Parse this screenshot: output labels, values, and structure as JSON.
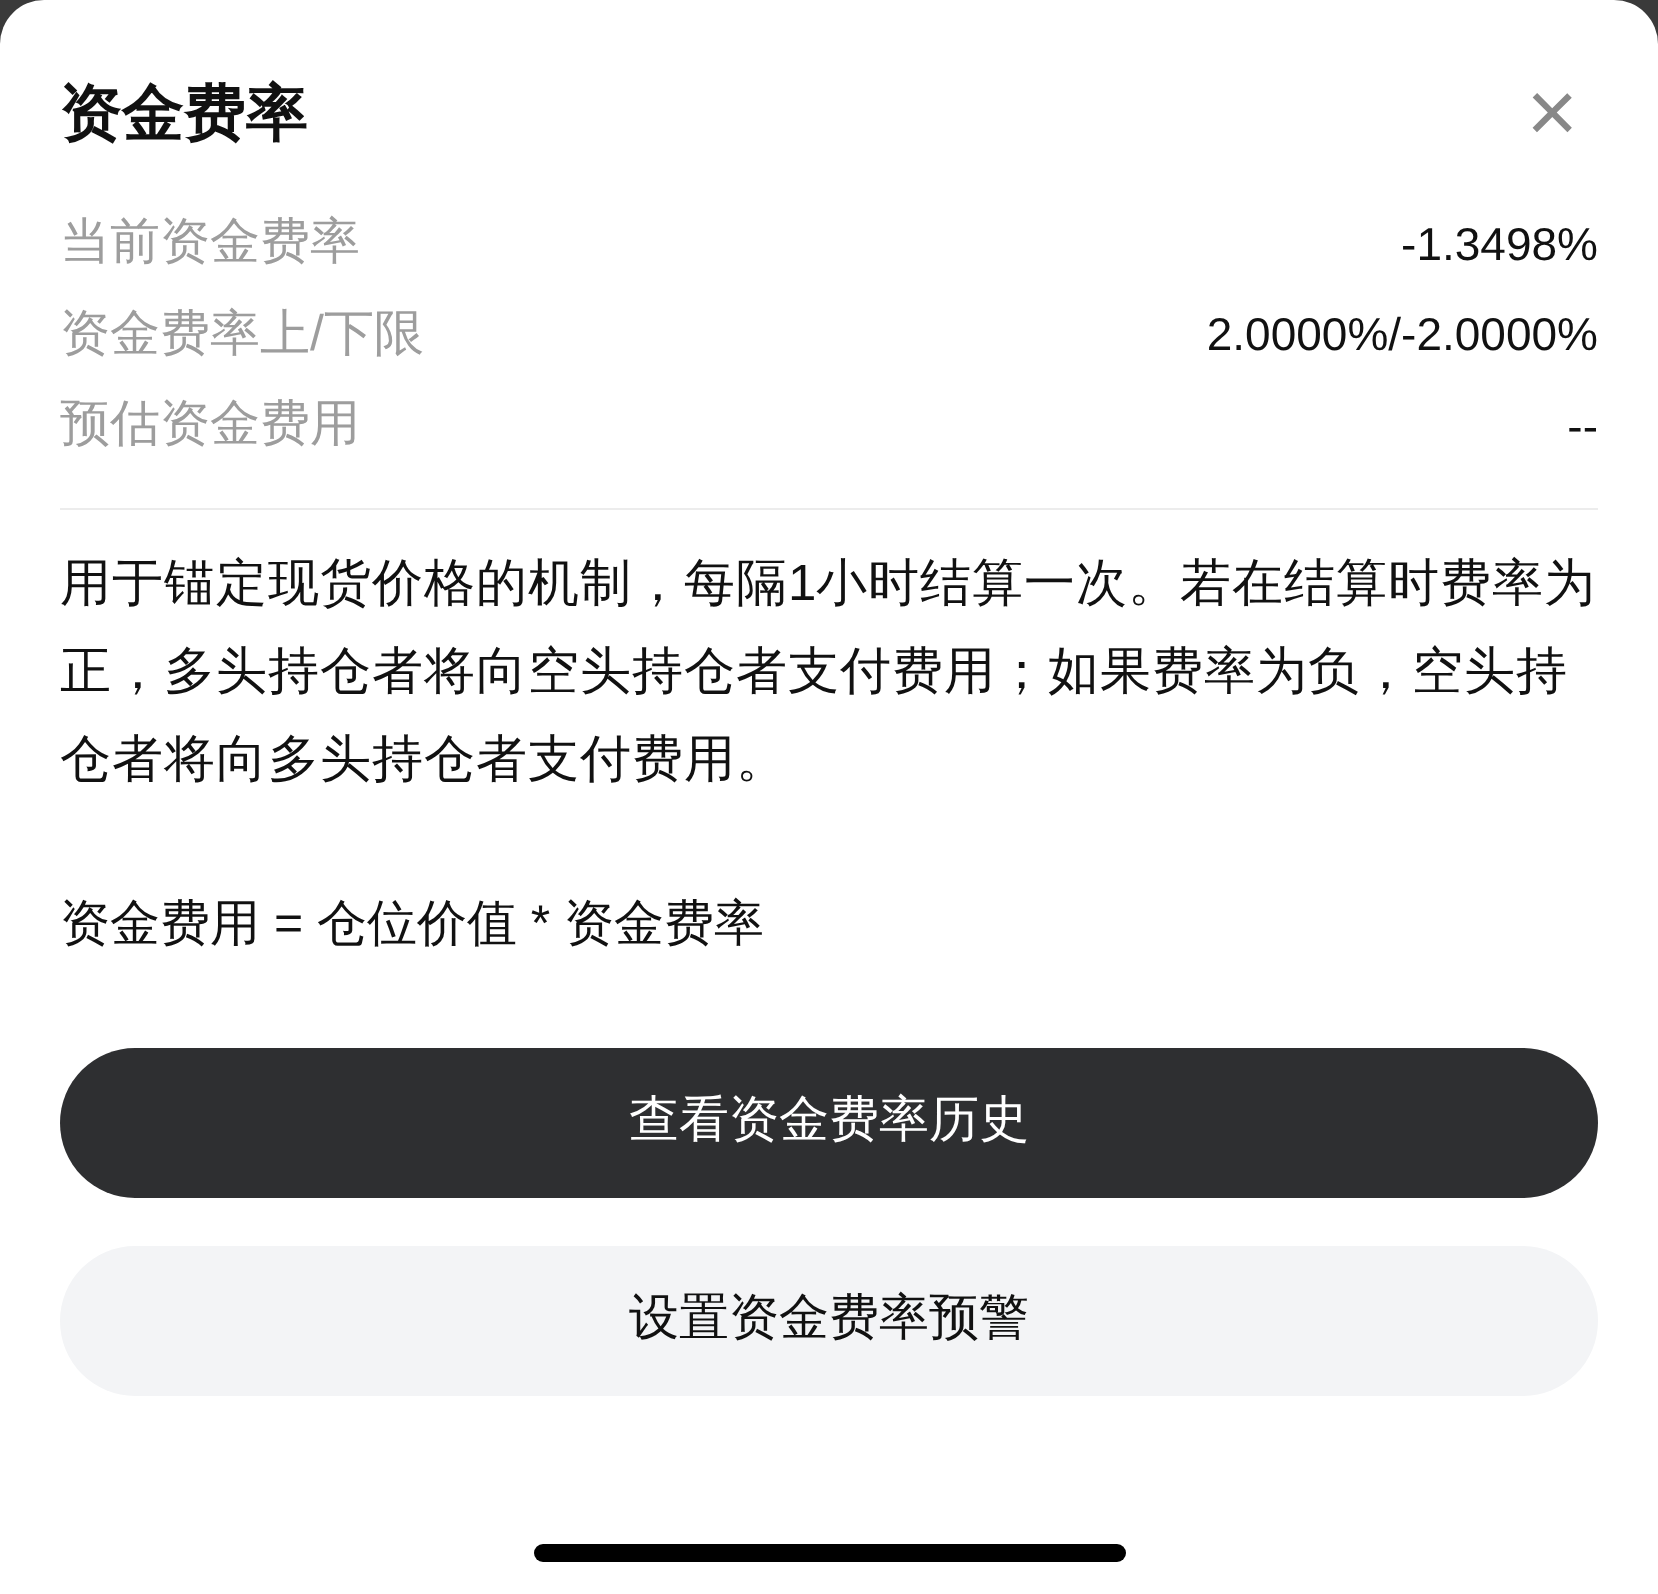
{
  "sheet": {
    "title": "资金费率",
    "close_icon": "×"
  },
  "rows": [
    {
      "label": "当前资金费率",
      "value": "-1.3498%"
    },
    {
      "label": "资金费率上/下限",
      "value": "2.0000%/-2.0000%"
    },
    {
      "label": "预估资金费用",
      "value": "--"
    }
  ],
  "description": "用于锚定现货价格的机制，每隔1小时结算一次。若在结算时费率为正，多头持仓者将向空头持仓者支付费用；如果费率为负，空头持仓者将向多头持仓者支付费用。",
  "formula": "资金费用 = 仓位价值 * 资金费率",
  "buttons": [
    {
      "label": "查看资金费率历史",
      "kind": "primary"
    },
    {
      "label": "设置资金费率预警",
      "kind": "secondary"
    }
  ]
}
